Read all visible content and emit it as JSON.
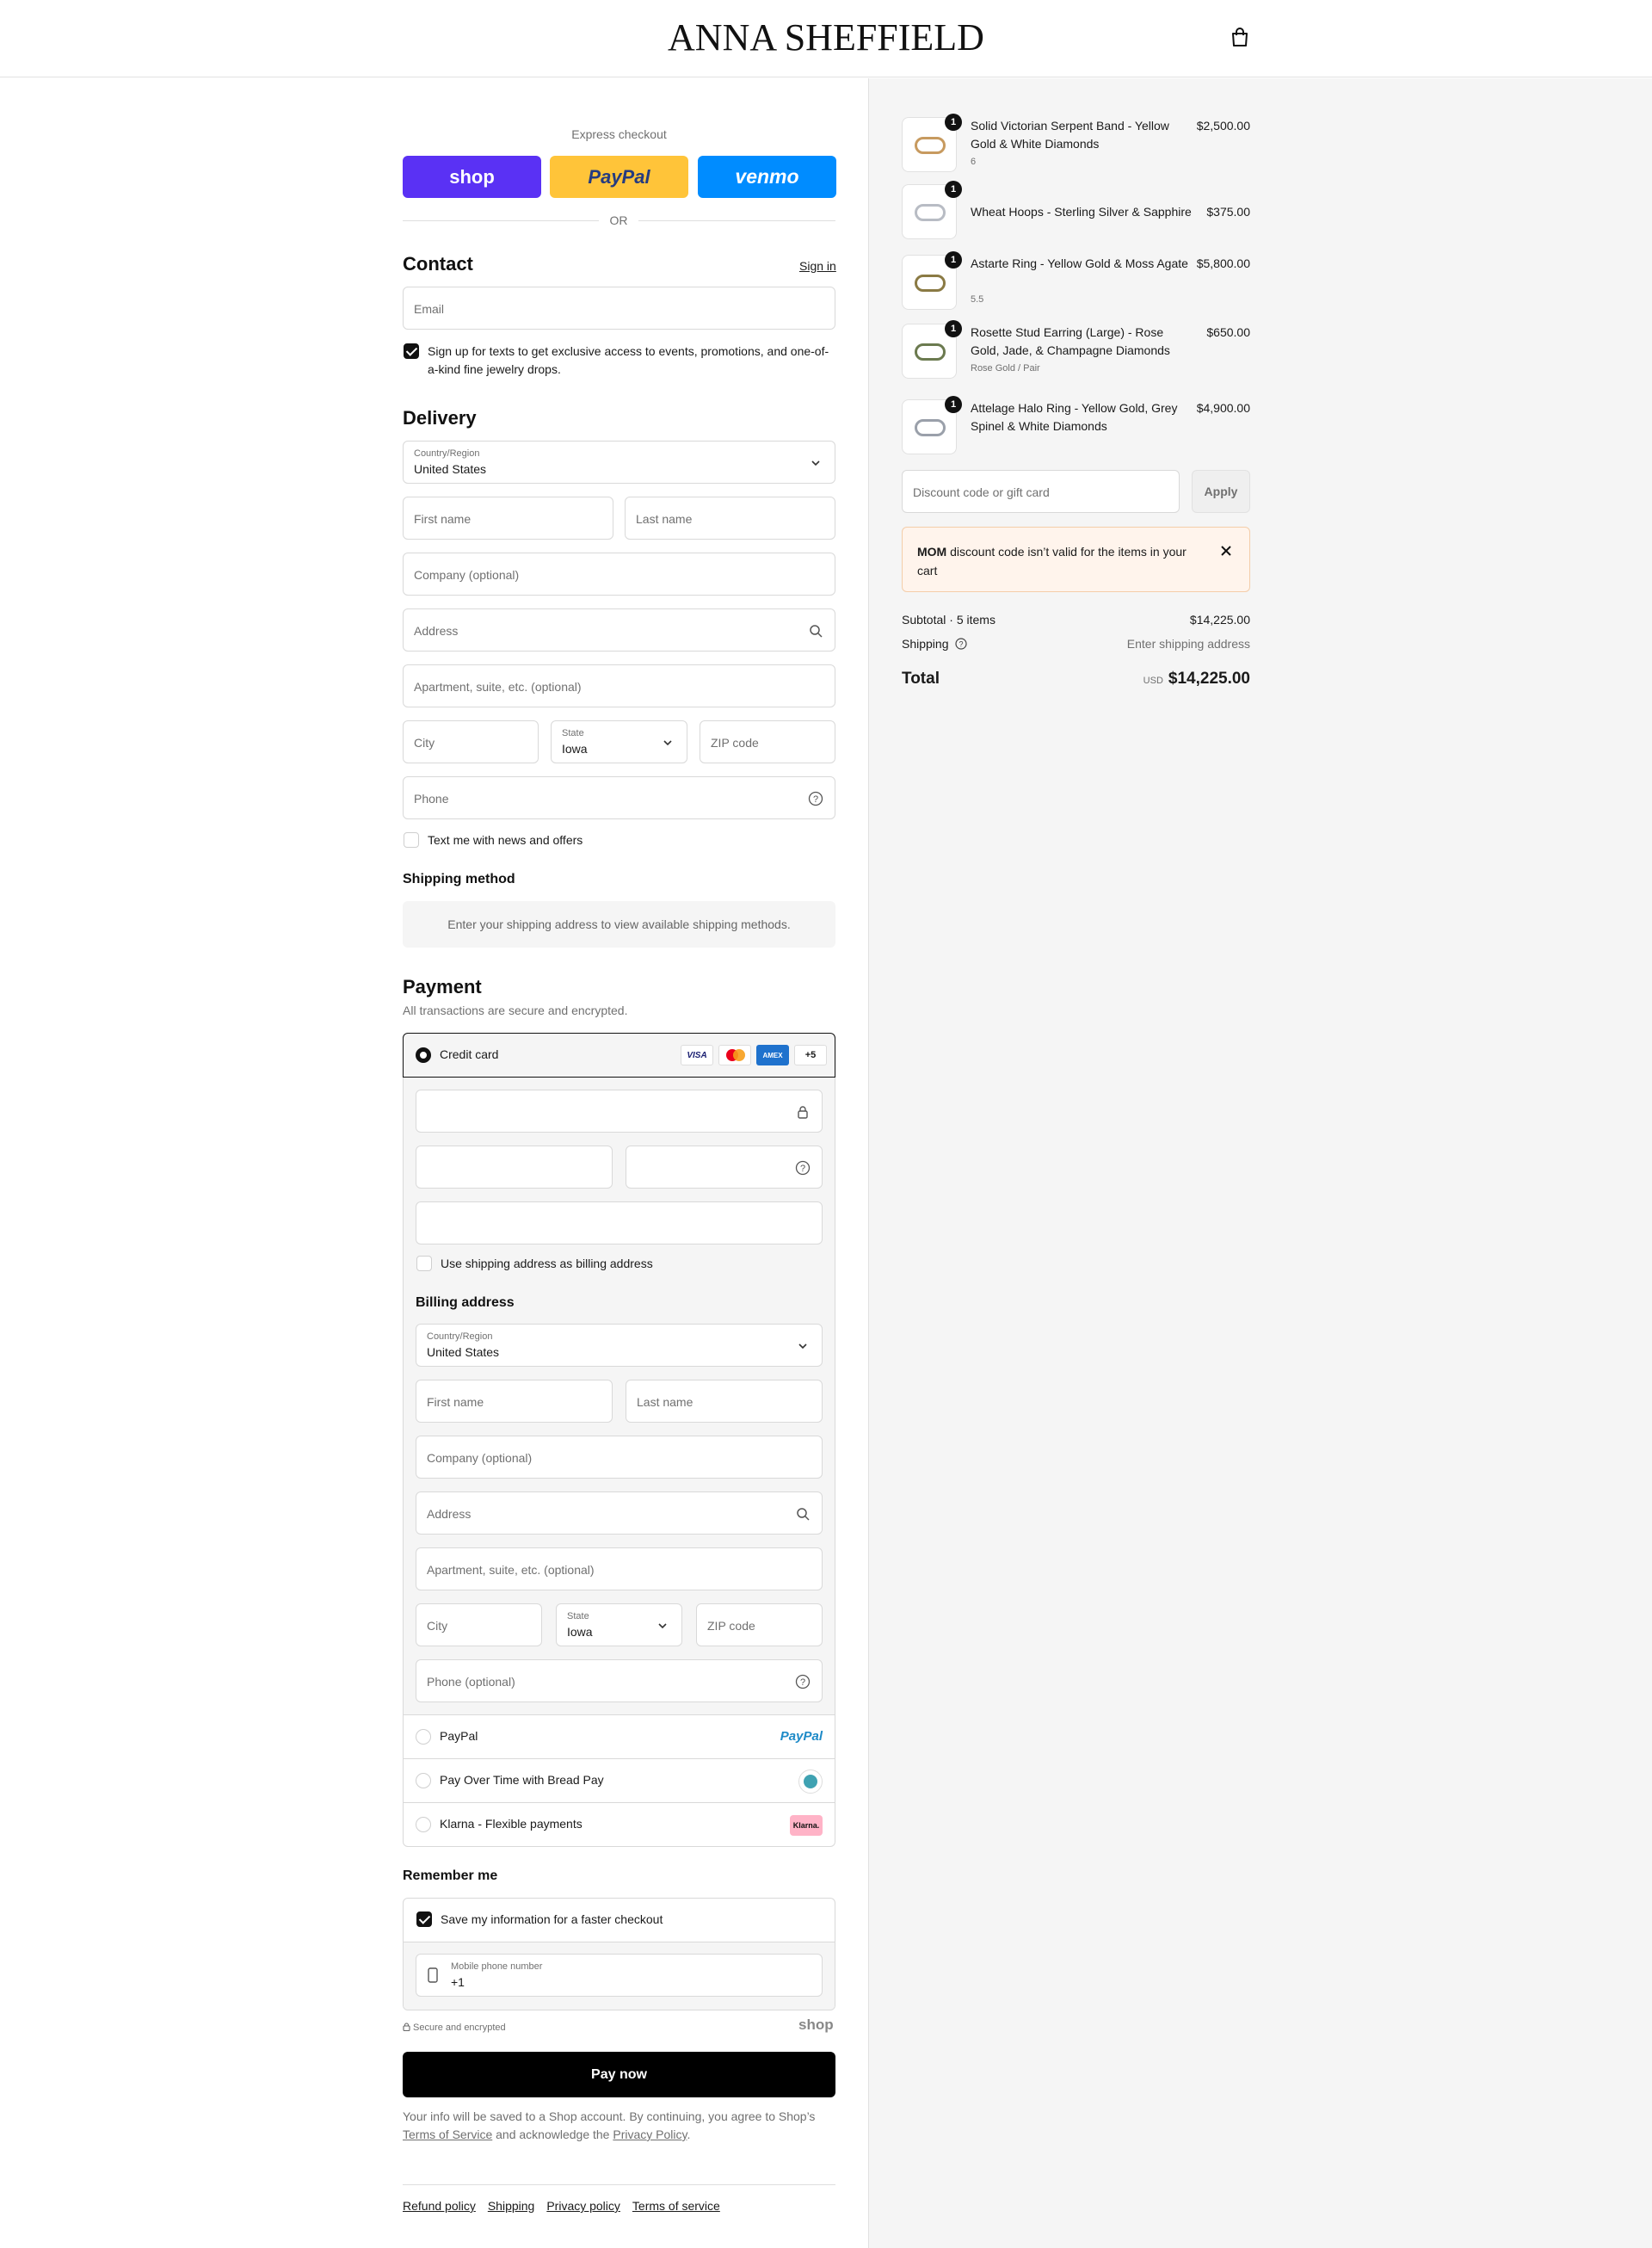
{
  "brand": "ANNA SHEFFIELD",
  "express": {
    "title": "Express checkout",
    "shop_label": "shop",
    "paypal_label": "PayPal",
    "venmo_label": "venmo",
    "or": "OR"
  },
  "contact": {
    "title": "Contact",
    "signin": "Sign in",
    "email_placeholder": "Email",
    "sms_optin": "Sign up for texts to get exclusive access to events, promotions, and one-of-a-kind fine jewelry drops.",
    "sms_checked": true
  },
  "delivery": {
    "title": "Delivery",
    "country_label": "Country/Region",
    "country_value": "United States",
    "first_name": "First name",
    "last_name": "Last name",
    "company": "Company (optional)",
    "address": "Address",
    "apartment": "Apartment, suite, etc. (optional)",
    "city": "City",
    "state_label": "State",
    "state_value": "Iowa",
    "zip": "ZIP code",
    "phone": "Phone",
    "text_offers": "Text me with news and offers"
  },
  "shipping_method": {
    "title": "Shipping method",
    "notice": "Enter your shipping address to view available shipping methods."
  },
  "payment": {
    "title": "Payment",
    "subtitle": "All transactions are secure and encrypted.",
    "credit_card_label": "Credit card",
    "card_more": "+5",
    "card_brands": [
      "VISA",
      "Mastercard",
      "AMEX"
    ],
    "use_shipping_as_billing": "Use shipping address as billing address",
    "billing": {
      "title": "Billing address",
      "country_label": "Country/Region",
      "country_value": "United States",
      "first_name": "First name",
      "last_name": "Last name",
      "company": "Company (optional)",
      "address": "Address",
      "apartment": "Apartment, suite, etc. (optional)",
      "city": "City",
      "state_label": "State",
      "state_value": "Iowa",
      "zip": "ZIP code",
      "phone": "Phone (optional)"
    },
    "methods": [
      {
        "label": "PayPal",
        "logo": "PayPal"
      },
      {
        "label": "Pay Over Time with Bread Pay",
        "logo": "bread-pay-icon"
      },
      {
        "label": "Klarna - Flexible payments",
        "logo": "Klarna."
      }
    ]
  },
  "remember": {
    "title": "Remember me",
    "save_info": "Save my information for a faster checkout",
    "mobile_label": "Mobile phone number",
    "mobile_value": "+1",
    "secure": "Secure and encrypted",
    "shop_logo": "shop"
  },
  "pay_now": "Pay now",
  "legal": {
    "line1": "Your info will be saved to a Shop account. By continuing, you agree to Shop’s",
    "terms": "Terms of Service",
    "and": "and acknowledge the",
    "privacy": "Privacy Policy",
    "end": "."
  },
  "footer_links": [
    "Refund policy",
    "Shipping",
    "Privacy policy",
    "Terms of service"
  ],
  "cart": {
    "items": [
      {
        "qty": "1",
        "name": "Solid Victorian Serpent Band - Yellow Gold & White Diamonds",
        "variant": "6",
        "price": "$2,500.00"
      },
      {
        "qty": "1",
        "name": "Wheat Hoops - Sterling Silver & Sapphire",
        "variant": "",
        "price": "$375.00"
      },
      {
        "qty": "1",
        "name": "Astarte Ring - Yellow Gold & Moss Agate",
        "variant": "5.5",
        "price": "$5,800.00"
      },
      {
        "qty": "1",
        "name": "Rosette Stud Earring (Large) - Rose Gold, Jade, & Champagne Diamonds",
        "variant": "Rose Gold / Pair",
        "price": "$650.00"
      },
      {
        "qty": "1",
        "name": "Attelage Halo Ring - Yellow Gold, Grey Spinel & White Diamonds",
        "variant": "",
        "price": "$4,900.00"
      }
    ],
    "discount_placeholder": "Discount code or gift card",
    "apply": "Apply",
    "error_code": "MOM",
    "error_text": "discount code isn’t valid for the items in your cart",
    "subtotal_label": "Subtotal · 5 items",
    "subtotal_value": "$14,225.00",
    "shipping_label": "Shipping",
    "shipping_value": "Enter shipping address",
    "total_label": "Total",
    "currency": "USD",
    "total_value": "$14,225.00"
  },
  "colors": {
    "shop_purple": "#5a31f4",
    "paypal_yellow": "#ffc439",
    "venmo_blue": "#008cff",
    "error_bg": "#fff4ec"
  }
}
